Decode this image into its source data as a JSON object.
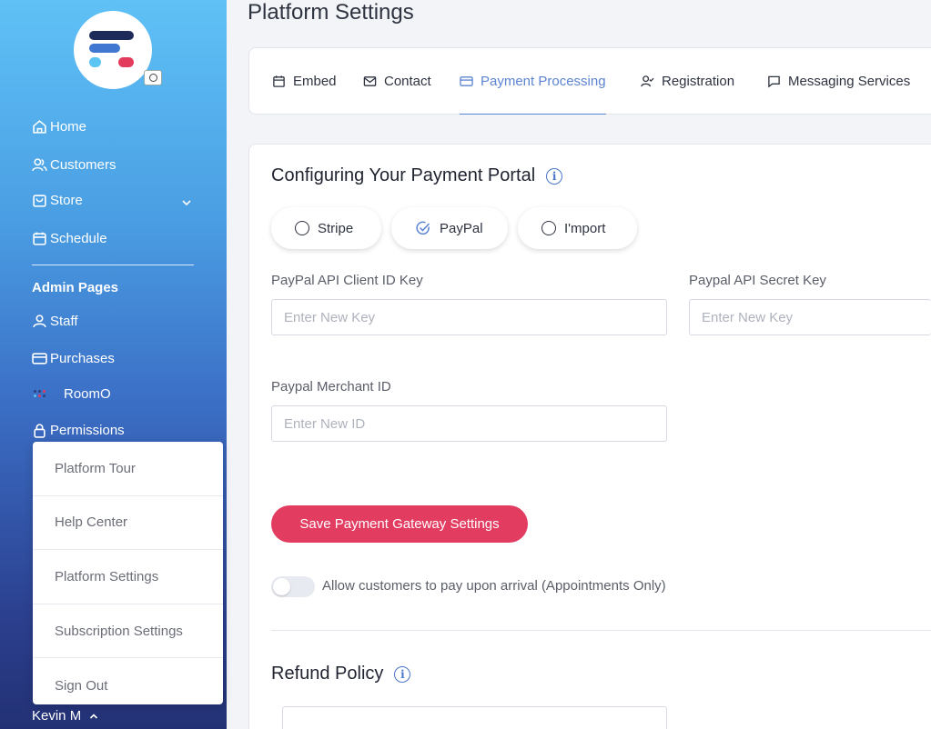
{
  "sidebar": {
    "nav": [
      {
        "label": "Home",
        "icon": "home-icon"
      },
      {
        "label": "Customers",
        "icon": "customers-icon"
      },
      {
        "label": "Store",
        "icon": "store-icon"
      },
      {
        "label": "Schedule",
        "icon": "calendar-icon"
      }
    ],
    "admin_title": "Admin Pages",
    "admin": [
      {
        "label": "Staff",
        "icon": "user-icon"
      },
      {
        "label": "Purchases",
        "icon": "card-icon"
      },
      {
        "label": "RoomO",
        "icon": "roomo-icon"
      },
      {
        "label": "Permissions",
        "icon": "lock-icon"
      }
    ],
    "user_name": "Kevin M"
  },
  "popup_menu": [
    "Platform Tour",
    "Help Center",
    "Platform Settings",
    "Subscription Settings",
    "Sign Out"
  ],
  "page_title": "Platform Settings",
  "tabs": [
    {
      "label": "Embed",
      "icon": "calendar-icon"
    },
    {
      "label": "Contact",
      "icon": "mail-icon"
    },
    {
      "label": "Payment Processing",
      "icon": "card-icon",
      "active": true
    },
    {
      "label": "Registration",
      "icon": "user-check-icon"
    },
    {
      "label": "Messaging Services",
      "icon": "chat-icon"
    }
  ],
  "payment": {
    "title": "Configuring Your Payment Portal",
    "providers": [
      {
        "label": "Stripe",
        "selected": false
      },
      {
        "label": "PayPal",
        "selected": true
      },
      {
        "label": "I'mport",
        "selected": false
      }
    ],
    "client_id_label": "PayPal API Client ID Key",
    "client_id_placeholder": "Enter New Key",
    "secret_label": "Paypal API Secret Key",
    "secret_placeholder": "Enter New Key",
    "merchant_label": "Paypal Merchant ID",
    "merchant_placeholder": "Enter New ID",
    "save_label": "Save Payment Gateway Settings",
    "toggle_label": "Allow customers to pay upon arrival (Appointments Only)"
  },
  "refund": {
    "title": "Refund Policy"
  },
  "colors": {
    "accent": "#5c84d3",
    "save_button": "#e23c60"
  }
}
